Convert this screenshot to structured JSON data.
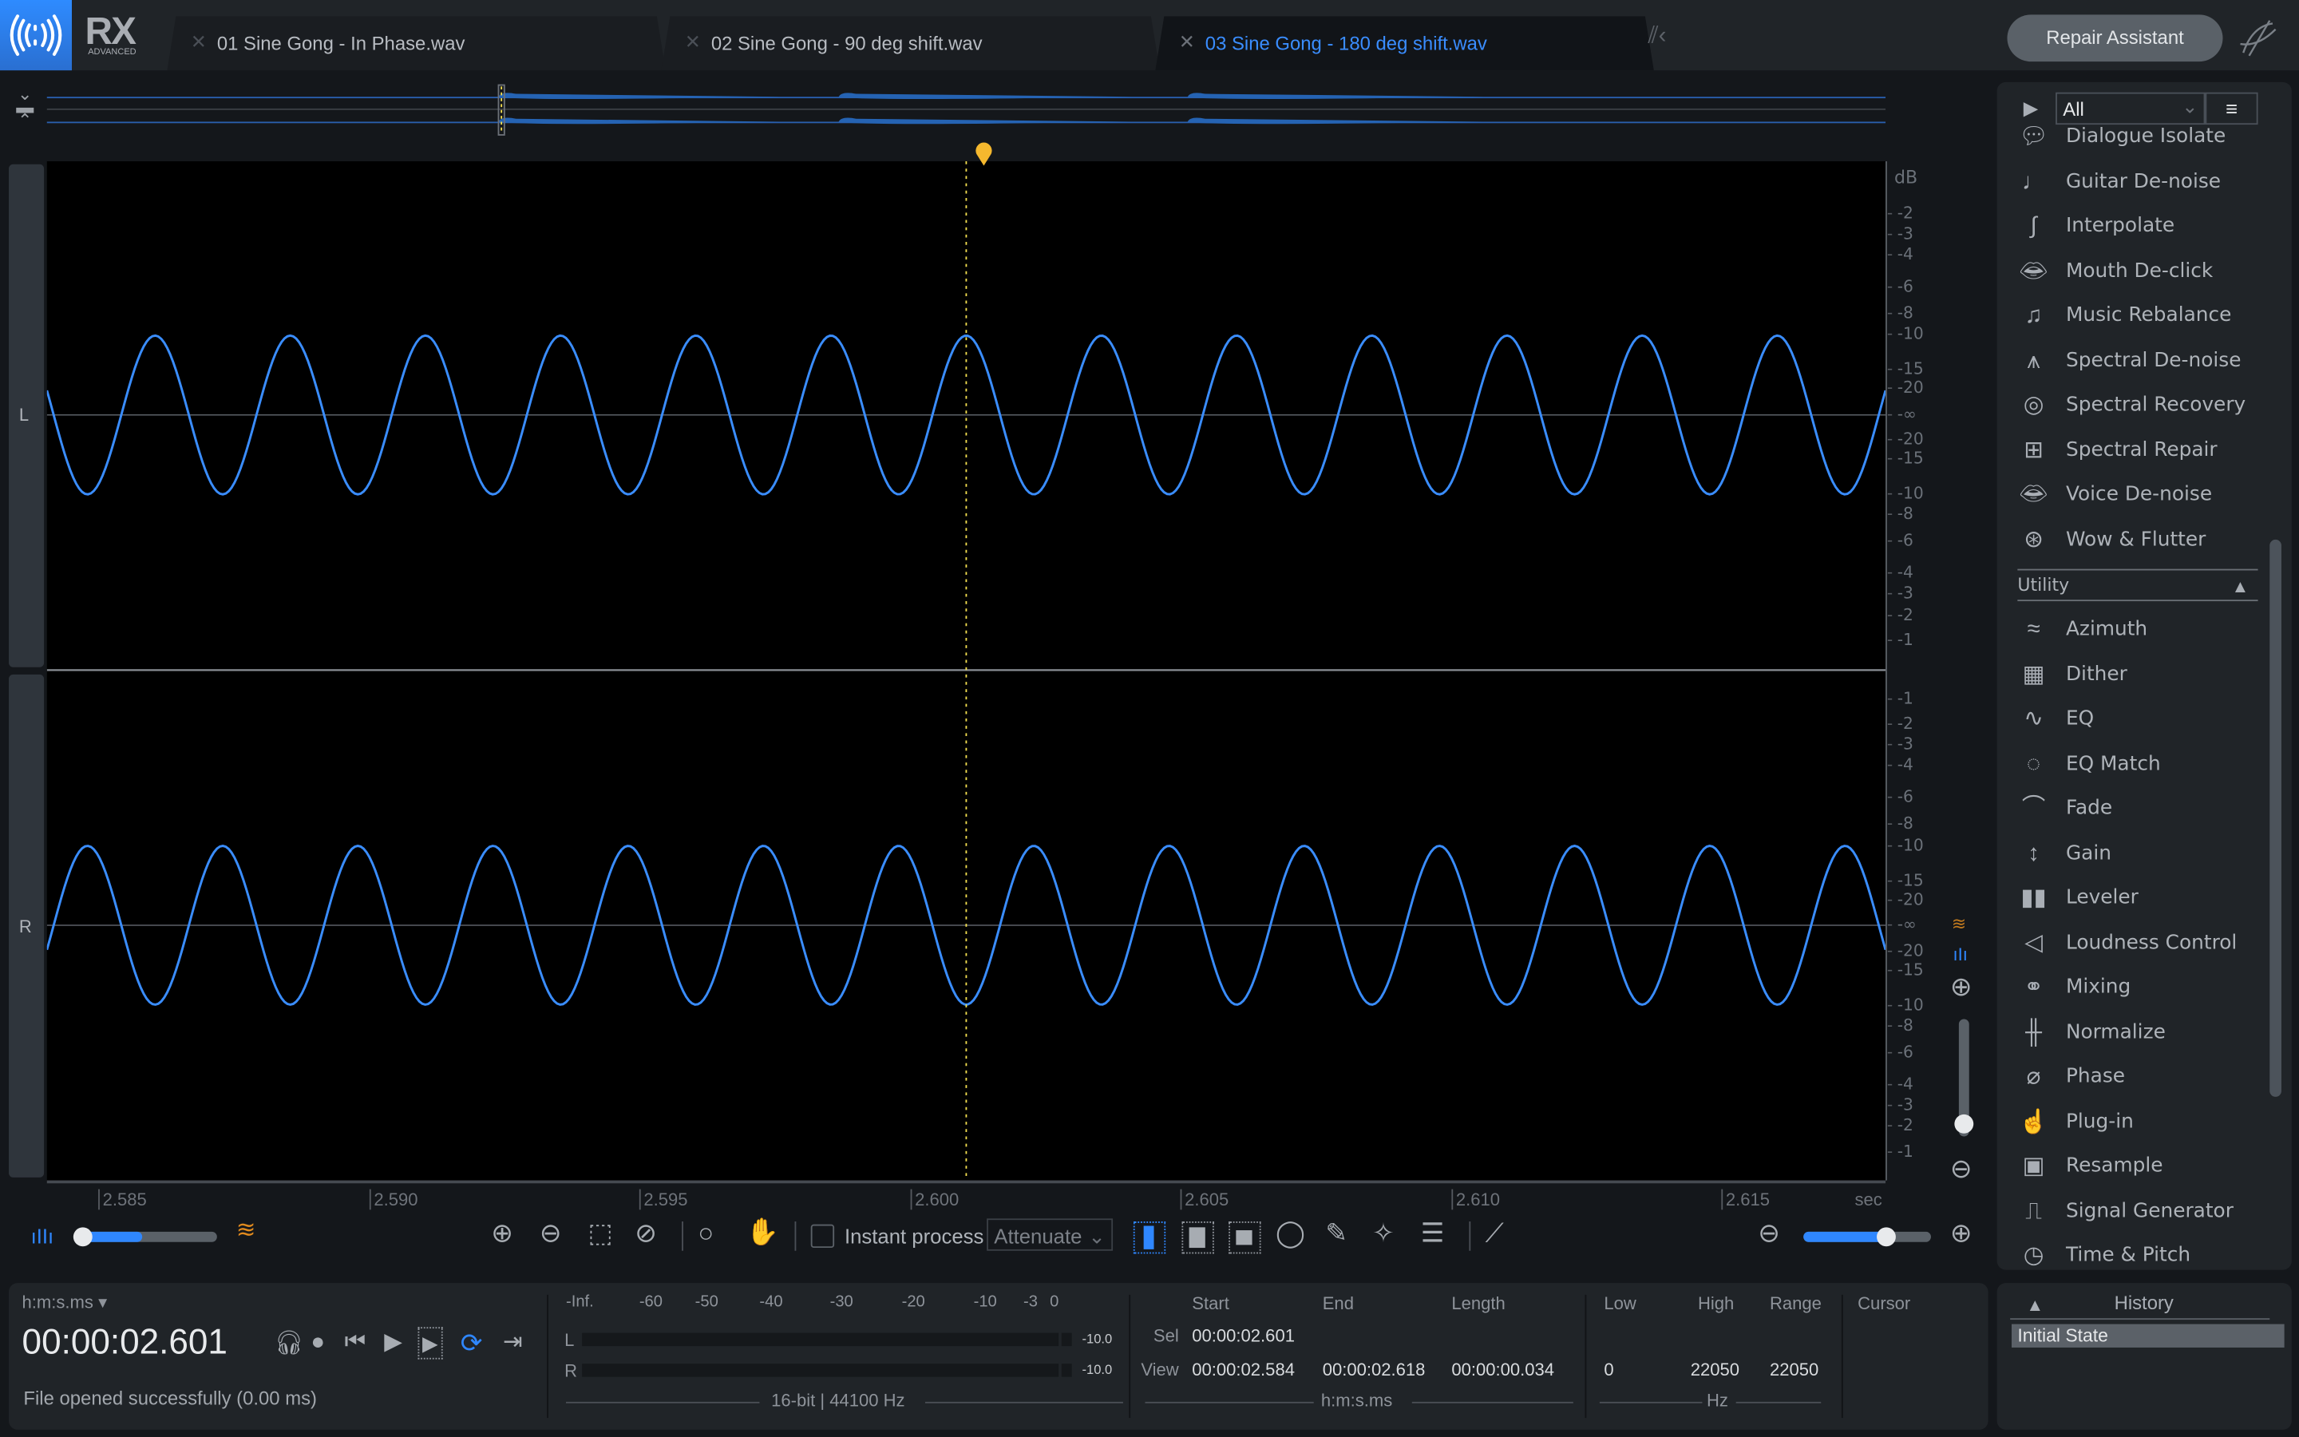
{
  "app": {
    "name": "RX",
    "edition": "ADVANCED"
  },
  "tabs": [
    {
      "label": "01 Sine Gong - In Phase.wav",
      "active": false
    },
    {
      "label": "02 Sine Gong - 90 deg shift.wav",
      "active": false
    },
    {
      "label": "03 Sine Gong - 180 deg shift.wav",
      "active": true
    }
  ],
  "header": {
    "repair_assistant_label": "Repair Assistant"
  },
  "colors": {
    "accent": "#2f87ff",
    "waveform": "#3a8dff",
    "playhead": "#f5b82e",
    "background": "#000000"
  },
  "waveform": {
    "channels": [
      {
        "label": "L"
      },
      {
        "label": "R"
      }
    ],
    "phase_shift_deg": 180,
    "cycles_in_view": 13.6,
    "peak_fraction": 0.3,
    "playhead_time_sec": 2.601,
    "db_unit": "dB",
    "db_labels_top": [
      "-2",
      "-3",
      "-4",
      "-6",
      "-8",
      "-10",
      "-15",
      "-20",
      "-∞",
      "-20",
      "-15",
      "-10",
      "-8",
      "-6",
      "-4",
      "-3",
      "-2",
      "-1"
    ],
    "db_labels_bottom": [
      "-1",
      "-2",
      "-3",
      "-4",
      "-6",
      "-8",
      "-10",
      "-15",
      "-20",
      "-∞",
      "-20",
      "-15",
      "-10",
      "-8",
      "-6",
      "-4",
      "-3",
      "-2",
      "-1"
    ]
  },
  "time_axis": {
    "ticks": [
      "2.585",
      "2.590",
      "2.595",
      "2.600",
      "2.605",
      "2.610",
      "2.615"
    ],
    "unit": "sec"
  },
  "toolbar": {
    "instant_process_label": "Instant process",
    "instant_process_checked": false,
    "mode_select_value": "Attenuate",
    "waveform_spectrogram_blend": 0.45,
    "zoom_level": 0.64
  },
  "module_panel": {
    "filter_value": "All",
    "items_top": [
      {
        "label": "Dialogue Isolate",
        "icon": "speech-bubble-icon"
      },
      {
        "label": "Guitar De-noise",
        "icon": "guitar-icon"
      },
      {
        "label": "Interpolate",
        "icon": "interpolate-icon"
      },
      {
        "label": "Mouth De-click",
        "icon": "mouth-click-icon"
      },
      {
        "label": "Music Rebalance",
        "icon": "music-note-icon"
      },
      {
        "label": "Spectral De-noise",
        "icon": "spectral-noise-icon"
      },
      {
        "label": "Spectral Recovery",
        "icon": "lifebuoy-icon"
      },
      {
        "label": "Spectral Repair",
        "icon": "plus-box-icon"
      },
      {
        "label": "Voice De-noise",
        "icon": "lips-icon"
      },
      {
        "label": "Wow & Flutter",
        "icon": "reel-icon"
      }
    ],
    "utility_header": "Utility",
    "items_utility": [
      {
        "label": "Azimuth",
        "icon": "azimuth-waves-icon"
      },
      {
        "label": "Dither",
        "icon": "dither-icon"
      },
      {
        "label": "EQ",
        "icon": "eq-curve-icon"
      },
      {
        "label": "EQ Match",
        "icon": "eq-match-icon"
      },
      {
        "label": "Fade",
        "icon": "fade-curve-icon"
      },
      {
        "label": "Gain",
        "icon": "gain-arrows-icon"
      },
      {
        "label": "Leveler",
        "icon": "leveler-icon"
      },
      {
        "label": "Loudness Control",
        "icon": "speaker-icon"
      },
      {
        "label": "Mixing",
        "icon": "circles-icon"
      },
      {
        "label": "Normalize",
        "icon": "normalize-icon"
      },
      {
        "label": "Phase",
        "icon": "phase-icon"
      },
      {
        "label": "Plug-in",
        "icon": "plugin-hand-icon"
      },
      {
        "label": "Resample",
        "icon": "resample-icon"
      },
      {
        "label": "Signal Generator",
        "icon": "signal-generator-icon"
      },
      {
        "label": "Time & Pitch",
        "icon": "time-pitch-icon"
      }
    ]
  },
  "transport": {
    "time_format": "h:m:s.ms",
    "current_time": "00:00:02.601",
    "status": "File opened successfully (0.00 ms)"
  },
  "meters": {
    "scale": [
      "-Inf.",
      "-60",
      "-50",
      "-40",
      "-30",
      "-20",
      "-10",
      "-3",
      "0"
    ],
    "left_label": "L",
    "right_label": "R",
    "left_peak": "-10.0",
    "right_peak": "-10.0",
    "format": "16-bit | 44100 Hz"
  },
  "selection": {
    "headers": {
      "start": "Start",
      "end": "End",
      "length": "Length",
      "low": "Low",
      "high": "High",
      "range": "Range",
      "cursor": "Cursor"
    },
    "sel": {
      "label": "Sel",
      "start": "00:00:02.601",
      "end": "",
      "length": ""
    },
    "view": {
      "label": "View",
      "start": "00:00:02.584",
      "end": "00:00:02.618",
      "length": "00:00:00.034",
      "low": "0",
      "high": "22050",
      "range": "22050"
    },
    "time_unit": "h:m:s.ms",
    "freq_unit": "Hz"
  },
  "history": {
    "title": "History",
    "items": [
      "Initial State"
    ]
  }
}
